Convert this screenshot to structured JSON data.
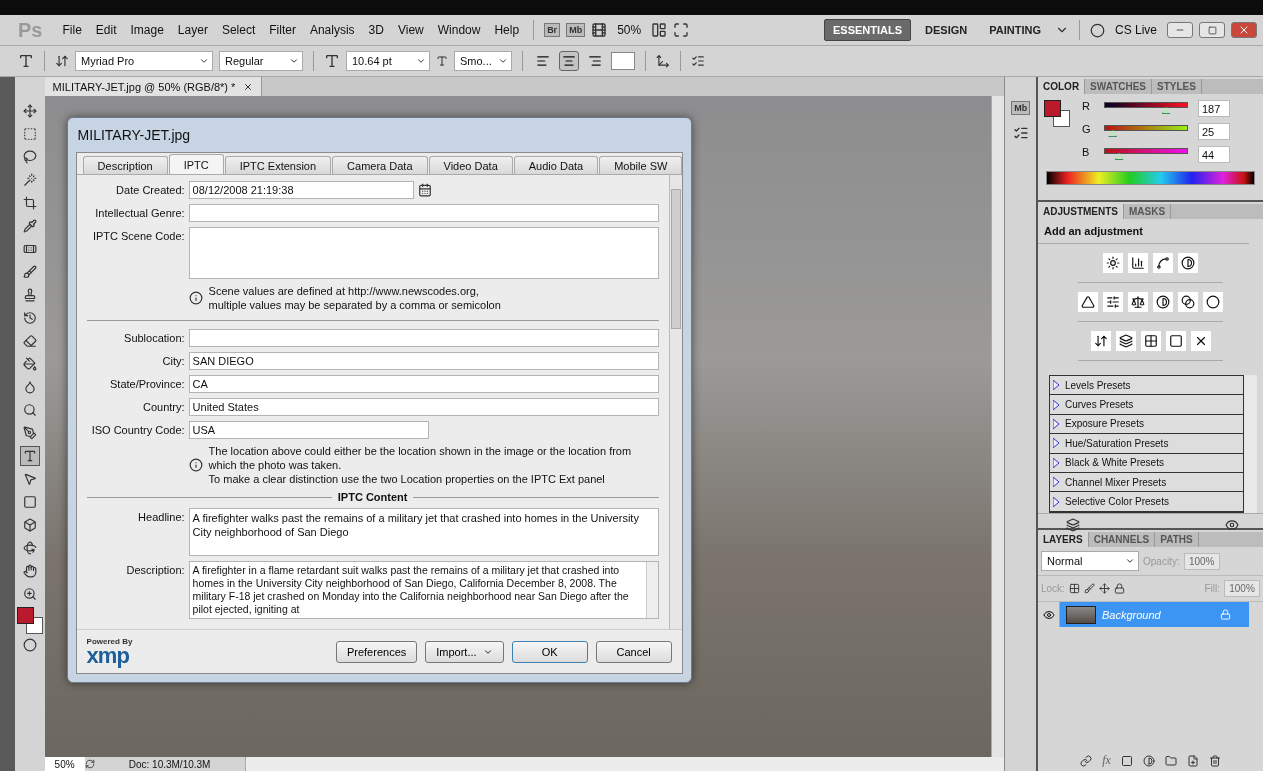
{
  "menu_bar": {
    "app_logo": "Ps",
    "menus": [
      "File",
      "Edit",
      "Image",
      "Layer",
      "Select",
      "Filter",
      "Analysis",
      "3D",
      "View",
      "Window",
      "Help"
    ],
    "bridge": "Br",
    "mini_bridge": "Mb",
    "zoom": "50%",
    "workspaces": [
      {
        "label": "ESSENTIALS",
        "selected": true
      },
      {
        "label": "DESIGN",
        "selected": false
      },
      {
        "label": "PAINTING",
        "selected": false
      }
    ],
    "cs_live": "CS Live"
  },
  "options_bar": {
    "font_family": "Myriad Pro",
    "font_style": "Regular",
    "font_size": "10.64 pt",
    "antialias": "Smo...",
    "alignment": [
      {
        "kind": "left",
        "selected": false
      },
      {
        "kind": "center",
        "selected": true
      },
      {
        "kind": "right",
        "selected": false
      }
    ]
  },
  "dock": {
    "mini_bridge": "Mb"
  },
  "document_tab": "MILITARY-JET.jpg @ 50% (RGB/8*) *",
  "dialog": {
    "title": "MILITARY-JET.jpg",
    "tabs": [
      {
        "label": "Description",
        "selected": false
      },
      {
        "label": "IPTC",
        "selected": true
      },
      {
        "label": "IPTC Extension",
        "selected": false
      },
      {
        "label": "Camera Data",
        "selected": false
      },
      {
        "label": "Video Data",
        "selected": false
      },
      {
        "label": "Audio Data",
        "selected": false
      },
      {
        "label": "Mobile SW",
        "selected": false
      }
    ],
    "items": [
      {
        "kind": "date",
        "label": "Date Created:",
        "value": "08/12/2008 21:19:38"
      },
      {
        "kind": "text",
        "label": "Intellectual Genre:"
      },
      {
        "kind": "area",
        "label": "IPTC Scene Code:"
      },
      {
        "kind": "note",
        "lines": [
          "Scene values are defined at http://www.newscodes.org,",
          "multiple values may be separated by a comma or semicolon"
        ]
      },
      {
        "kind": "divider"
      },
      {
        "kind": "text",
        "label": "Sublocation:"
      },
      {
        "kind": "text",
        "label": "City:",
        "value": "SAN DIEGO"
      },
      {
        "kind": "text",
        "label": "State/Province:",
        "value": "CA"
      },
      {
        "kind": "text",
        "label": "Country:",
        "value": "United States"
      },
      {
        "kind": "short",
        "label": "ISO Country Code:",
        "value": "USA"
      },
      {
        "kind": "note",
        "lines": [
          "The location above could either be the location shown in the image or the location from which the photo was taken."
        ],
        "extra": "To make a clear distinction use the two Location properties on the IPTC Ext panel"
      },
      {
        "kind": "section",
        "label": "IPTC Content"
      },
      {
        "kind": "area",
        "label": "Headline:",
        "value": "A firefighter walks past the remains of a military jet that crashed into homes in the University City neighborhood of San Diego"
      },
      {
        "kind": "scroll",
        "label": "Description:",
        "value": "A firefighter in a flame retardant suit walks past the remains of a military jet that crashed into homes in the University City neighborhood of San Diego, California December 8, 2008. The military F-18 jet crashed on Monday into the California neighborhood near San Diego after the pilot ejected, igniting at"
      }
    ],
    "powered_by": "Powered By",
    "logo": "xmp",
    "buttons": [
      {
        "label": "Preferences",
        "kind": "plain"
      },
      {
        "label": "Import...",
        "kind": "split"
      },
      {
        "label": "OK",
        "kind": "default"
      },
      {
        "label": "Cancel",
        "kind": "plain"
      }
    ]
  },
  "color_panel": {
    "tabs": [
      {
        "label": "COLOR",
        "selected": true
      },
      {
        "label": "SWATCHES",
        "selected": false
      },
      {
        "label": "STYLES",
        "selected": false
      }
    ],
    "channels": [
      {
        "name": "R",
        "value": "187",
        "level": 0.733
      },
      {
        "name": "G",
        "value": "25",
        "level": 0.098
      },
      {
        "name": "B",
        "value": "44",
        "level": 0.173
      }
    ]
  },
  "adjustments_panel": {
    "tabs": [
      {
        "label": "ADJUSTMENTS",
        "selected": true
      },
      {
        "label": "MASKS",
        "selected": false
      }
    ],
    "heading": "Add an adjustment",
    "presets": [
      "Levels Presets",
      "Curves Presets",
      "Exposure Presets",
      "Hue/Saturation Presets",
      "Black & White Presets",
      "Channel Mixer Presets",
      "Selective Color Presets"
    ]
  },
  "layers_panel": {
    "tabs": [
      {
        "label": "LAYERS",
        "selected": true
      },
      {
        "label": "CHANNELS",
        "selected": false
      },
      {
        "label": "PATHS",
        "selected": false
      }
    ],
    "blend_mode": "Normal",
    "opacity_label": "Opacity:",
    "opacity": "100%",
    "lock_label": "Lock:",
    "fill_label": "Fill:",
    "fill": "100%",
    "layers": [
      {
        "name": "Background",
        "selected": true,
        "visible": true
      }
    ],
    "fx_label": "fx"
  },
  "status_bar": {
    "zoom": "50%",
    "doc_size": "Doc: 10.3M/10.3M"
  }
}
